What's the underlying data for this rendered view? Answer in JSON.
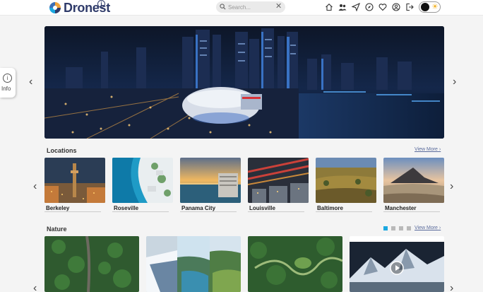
{
  "brand": {
    "name": "Dronest",
    "info_badge": "i"
  },
  "search": {
    "placeholder": "Search...",
    "clear": "✕"
  },
  "nav_icons": [
    "home-icon",
    "users-icon",
    "send-icon",
    "compass-icon",
    "heart-icon",
    "account-icon",
    "logout-icon"
  ],
  "theme_toggle": {
    "sun": "☀"
  },
  "info_tab": {
    "icon": "i",
    "label": "Info"
  },
  "hero": {
    "prev": "‹",
    "next": "›",
    "slide_count": 4,
    "active_slide": 0
  },
  "locations": {
    "title": "Locations",
    "view_more": "View More",
    "view_more_chevron": "›",
    "prev": "‹",
    "next": "›",
    "items": [
      {
        "name": "Berkeley"
      },
      {
        "name": "Roseville"
      },
      {
        "name": "Panama City"
      },
      {
        "name": "Louisville"
      },
      {
        "name": "Baltimore"
      },
      {
        "name": "Manchester"
      }
    ]
  },
  "nature": {
    "title": "Nature",
    "view_more": "View More",
    "view_more_chevron": "›",
    "pages": 4,
    "active_page": 0,
    "prev": "‹",
    "next": "›"
  },
  "colors": {
    "accent": "#1ba8e0",
    "brand": "#2f3b6a",
    "link": "#5a6b9c",
    "inactive_dot": "#b9b9b9"
  }
}
